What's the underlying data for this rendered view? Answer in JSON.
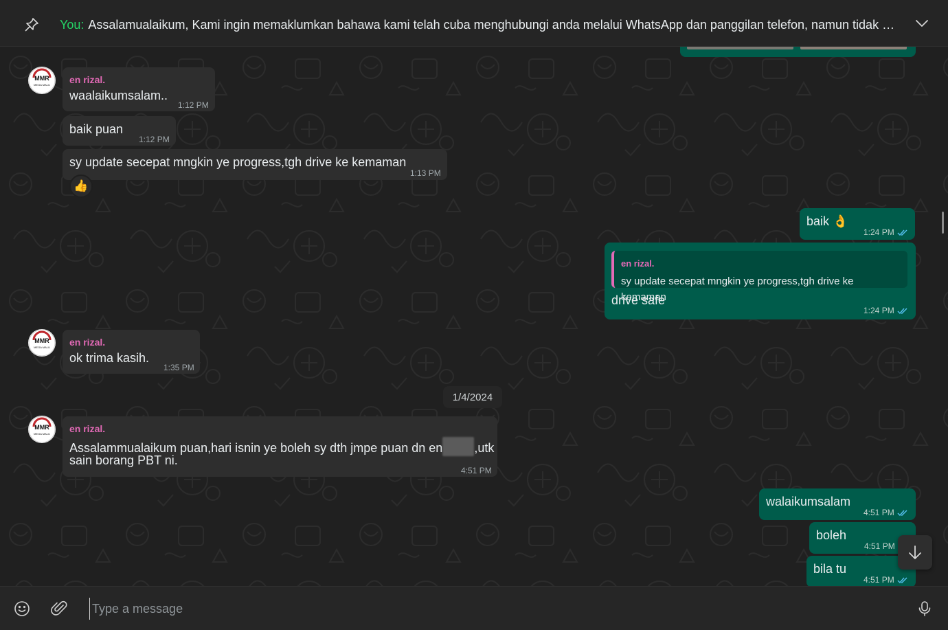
{
  "pinned": {
    "prefix": "You:",
    "text": "Assalamualaikum,  Kami ingin memaklumkan bahawa kami telah cuba menghubungi anda melalui WhatsApp dan panggilan telefon, namun tidak mener..."
  },
  "messages": [
    {
      "sender": "en rizal.",
      "text": "waalaikumsalam..",
      "time": "1:12 PM"
    },
    {
      "text": "baik puan",
      "time": "1:12 PM"
    },
    {
      "text": "sy update secepat mngkin ye progress,tgh drive ke kemaman",
      "time": "1:13 PM",
      "reaction": "👍"
    },
    {
      "text": "baik 👌",
      "time": "1:24 PM"
    },
    {
      "quote_sender": "en rizal.",
      "quote_text": "sy update secepat mngkin ye progress,tgh drive ke kemaman",
      "text": "drive safe",
      "time": "1:24 PM"
    },
    {
      "sender": "en rizal.",
      "text": "ok trima kasih.",
      "time": "1:35 PM"
    },
    {
      "sender": "en rizal.",
      "text_part1": "Assalammualaikum puan,hari isnin ye boleh sy dth jmpe puan dn en",
      "text_part2": ",utk",
      "text_line2": "sain borang PBT ni.",
      "time": "4:51 PM"
    },
    {
      "text": "walaikumsalam",
      "time": "4:51 PM"
    },
    {
      "text": "boleh",
      "time": "4:51 PM"
    },
    {
      "text": "bila tu",
      "time": "4:51 PM"
    }
  ],
  "date_divider": "1/4/2024",
  "composer": {
    "placeholder": "Type a message"
  },
  "colors": {
    "incoming": "#2e2e2e",
    "outgoing": "#005c4b",
    "sender_name": "#e26ab6",
    "pinned_you": "#25d366"
  }
}
